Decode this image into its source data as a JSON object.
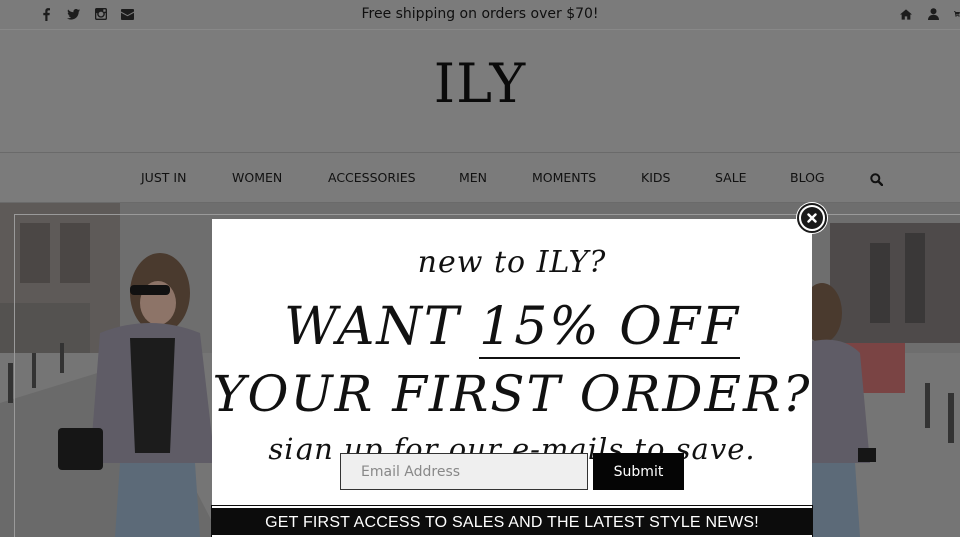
{
  "topbar": {
    "social_icons": [
      "facebook-icon",
      "twitter-icon",
      "instagram-icon",
      "envelope-icon"
    ],
    "promo_text": "Free shipping on orders over $70!",
    "utility_icons": [
      "home-icon",
      "user-icon",
      "cart-icon"
    ]
  },
  "header": {
    "logo": "ILY"
  },
  "nav": {
    "items": [
      {
        "label": "JUST IN"
      },
      {
        "label": "WOMEN"
      },
      {
        "label": "ACCESSORIES"
      },
      {
        "label": "MEN"
      },
      {
        "label": "MOMENTS"
      },
      {
        "label": "KIDS"
      },
      {
        "label": "SALE"
      },
      {
        "label": "BLOG"
      }
    ],
    "search_icon": "search-icon"
  },
  "modal": {
    "kicker": "new to ILY?",
    "headline_prefix": "WANT ",
    "headline_highlight": "15% OFF",
    "headline_line2": "YOUR FIRST ORDER?",
    "subheading": "sign up for our e-mails to save.",
    "email_placeholder": "Email Address",
    "submit_label": "Submit",
    "footer_bar": "GET FIRST ACCESS TO SALES AND THE LATEST STYLE NEWS!",
    "close_icon": "close-icon"
  },
  "colors": {
    "overlay": "#7c7c7c",
    "modal_bg": "#ffffff",
    "button_bg": "#050505"
  }
}
